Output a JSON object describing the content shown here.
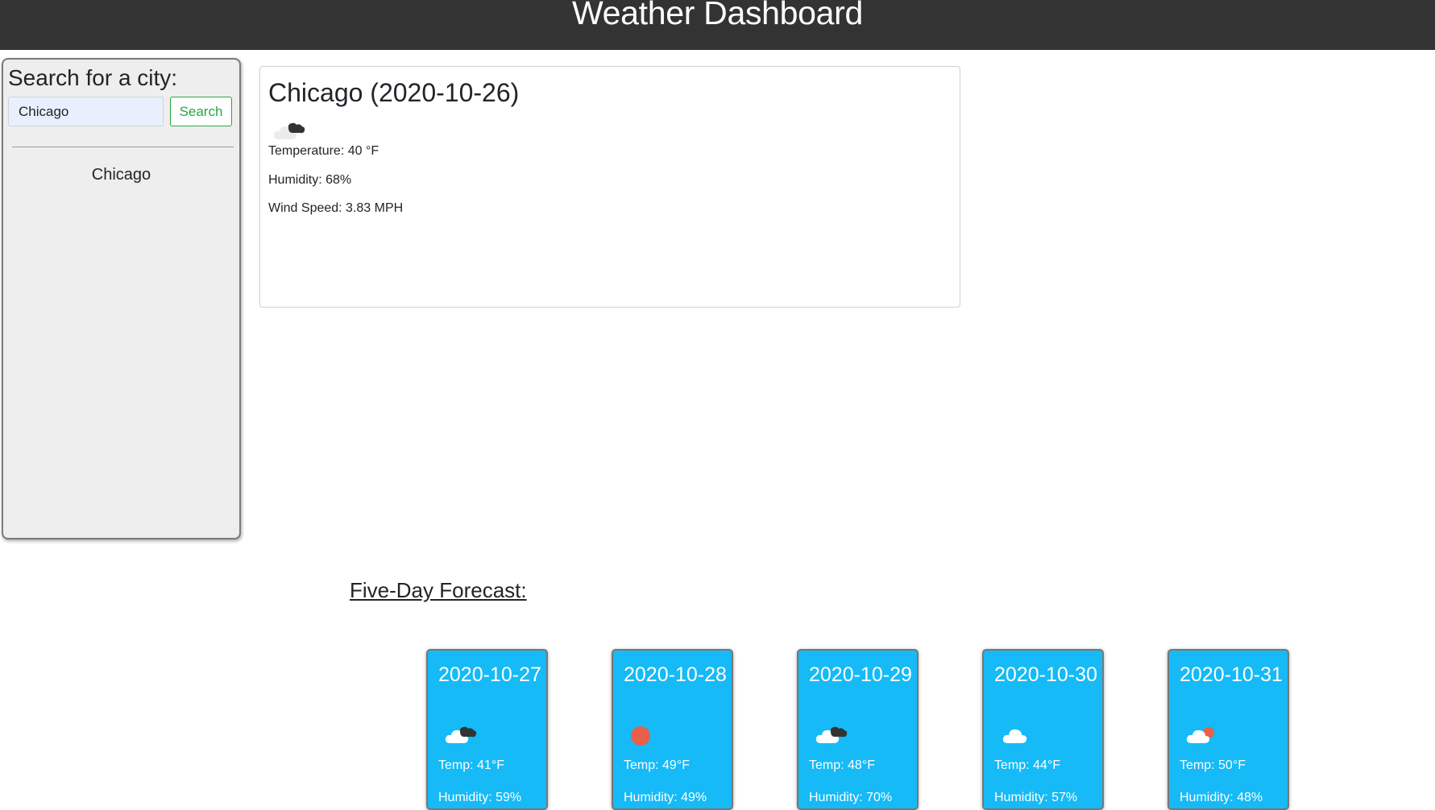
{
  "header": {
    "title": "Weather Dashboard"
  },
  "sidebar": {
    "heading": "Search for a city:",
    "search_value": "Chicago",
    "search_button_label": "Search",
    "history": [
      "Chicago"
    ]
  },
  "current": {
    "title": "Chicago (2020-10-26)",
    "icon": "broken-clouds-icon",
    "temperature": "Temperature: 40 °F",
    "humidity": "Humidity: 68%",
    "wind_speed": "Wind Speed: 3.83 MPH"
  },
  "forecast": {
    "heading": "Five-Day Forecast:",
    "days": [
      {
        "date": "2020-10-27",
        "icon": "broken-clouds-icon",
        "temp": "Temp: 41°F",
        "humidity": "Humidity: 59%"
      },
      {
        "date": "2020-10-28",
        "icon": "clear-sky-icon",
        "temp": "Temp: 49°F",
        "humidity": "Humidity: 49%"
      },
      {
        "date": "2020-10-29",
        "icon": "broken-clouds-icon",
        "temp": "Temp: 48°F",
        "humidity": "Humidity: 70%"
      },
      {
        "date": "2020-10-30",
        "icon": "cloud-icon",
        "temp": "Temp: 44°F",
        "humidity": "Humidity: 57%"
      },
      {
        "date": "2020-10-31",
        "icon": "few-clouds-icon",
        "temp": "Temp: 50°F",
        "humidity": "Humidity: 48%"
      }
    ]
  },
  "colors": {
    "header_bg": "#333333",
    "sidebar_bg": "#eeeeee",
    "forecast_card_bg": "#15baf7",
    "search_button": "#28a745",
    "sun": "#e8604a"
  }
}
